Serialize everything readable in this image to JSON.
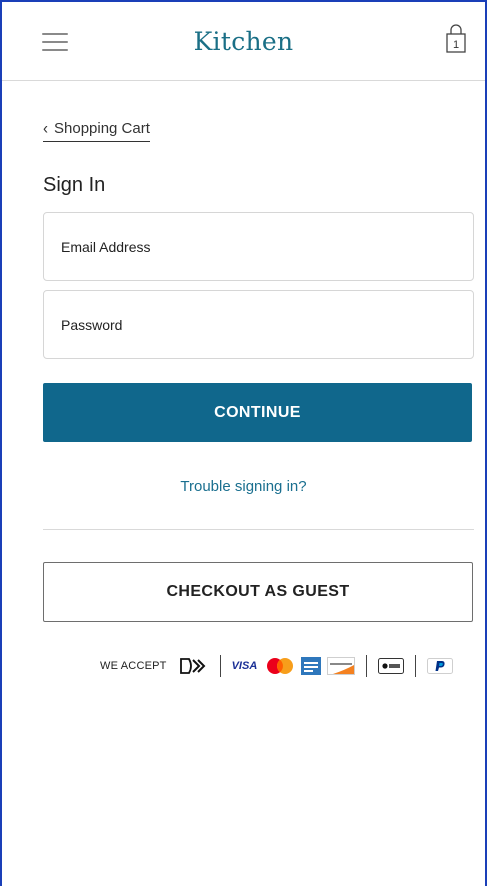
{
  "header": {
    "logo_text": "Kitchen",
    "cart_count": "1"
  },
  "back": {
    "label": "Shopping Cart"
  },
  "signin": {
    "title": "Sign In",
    "email_placeholder": "Email Address",
    "email_value": "",
    "password_placeholder": "Password",
    "password_value": "",
    "continue_label": "CONTINUE",
    "trouble_label": "Trouble signing in?"
  },
  "guest": {
    "label": "CHECKOUT AS GUEST"
  },
  "payments": {
    "label": "WE ACCEPT",
    "visa_label": "VISA",
    "icons": [
      "contactless-icon",
      "visa-icon",
      "mastercard-icon",
      "amex-icon",
      "discover-icon",
      "apple-pay-icon",
      "paypal-icon"
    ]
  },
  "colors": {
    "accent": "#10678c",
    "logo": "#1a6f86",
    "link": "#1a6f8f",
    "frame": "#1a3fb8"
  }
}
